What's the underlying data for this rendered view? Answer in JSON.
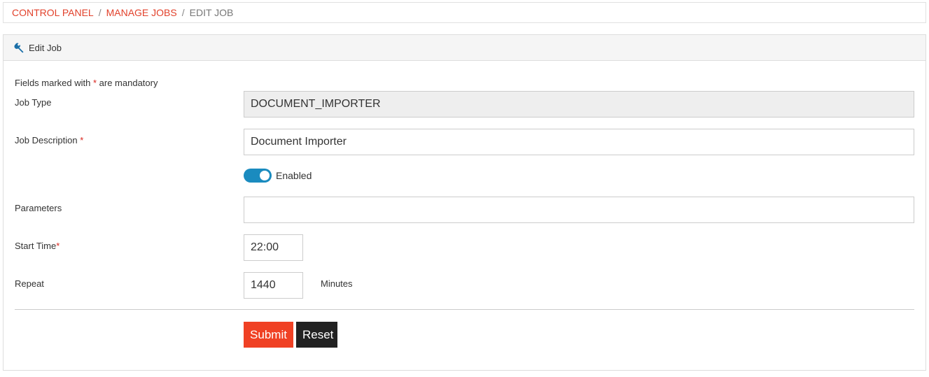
{
  "breadcrumb": {
    "items": [
      "CONTROL PANEL",
      "MANAGE JOBS"
    ],
    "current": "EDIT JOB",
    "separator": "/"
  },
  "panel": {
    "title": "Edit Job",
    "icon": "wrench-icon"
  },
  "form": {
    "mandatory_prefix": "Fields marked with ",
    "mandatory_star": "*",
    "mandatory_suffix": " are mandatory",
    "job_type_label": "Job Type",
    "job_type_value": "DOCUMENT_IMPORTER",
    "job_description_label": "Job Description",
    "job_description_value": "Document Importer",
    "enabled_label": "Enabled",
    "enabled": true,
    "parameters_label": "Parameters",
    "parameters_value": "",
    "start_time_label": "Start Time",
    "start_time_value": "22:00",
    "repeat_label": "Repeat",
    "repeat_value": "1440",
    "repeat_unit": "Minutes",
    "required_marker": "*"
  },
  "buttons": {
    "submit": "Submit",
    "reset": "Reset"
  },
  "colors": {
    "accent": "#e2412b",
    "submit": "#f04124",
    "reset": "#222222",
    "toggle": "#1a8bbf"
  }
}
